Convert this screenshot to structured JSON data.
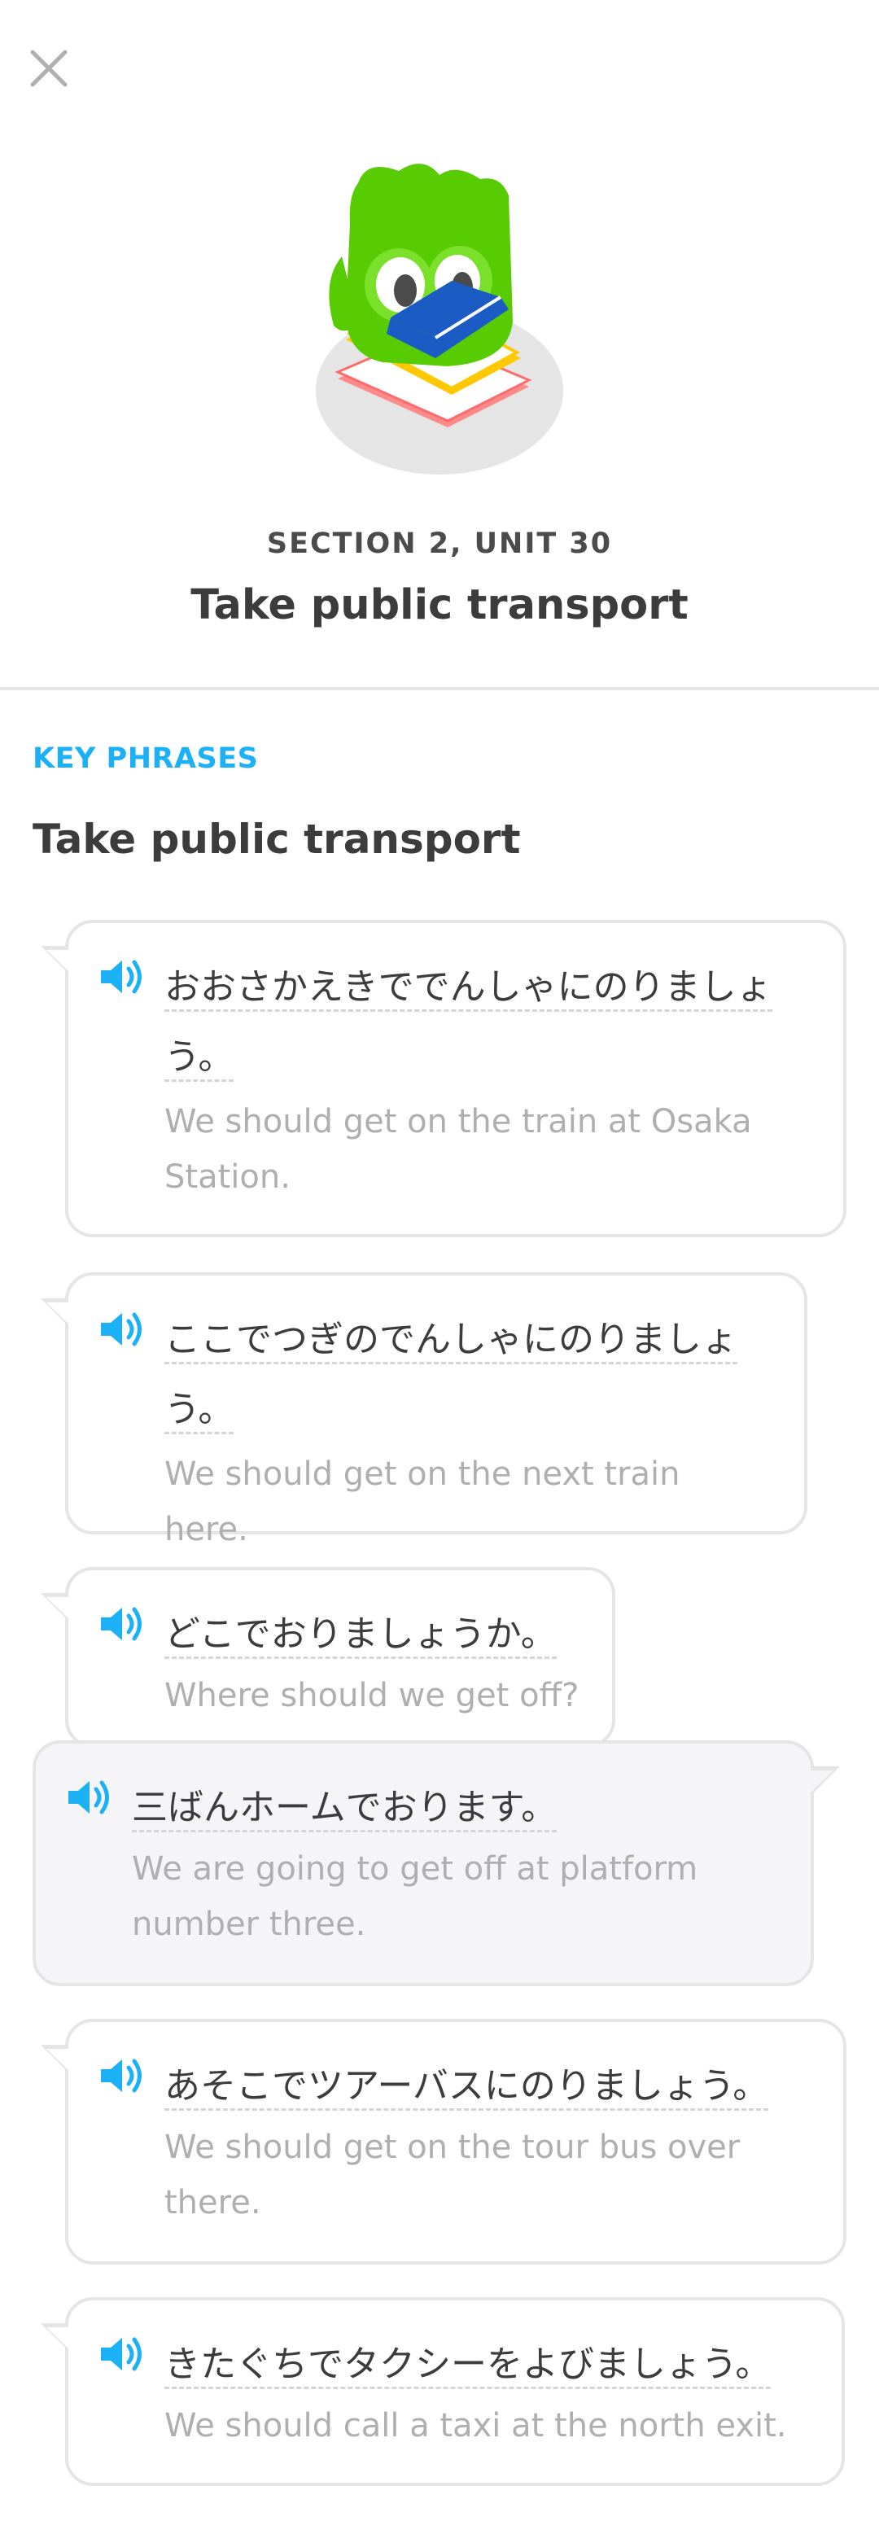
{
  "header": {
    "close_icon": "close-icon",
    "unit_label": "SECTION 2, UNIT 30",
    "unit_title": "Take public transport"
  },
  "key_phrases": {
    "kicker": "KEY PHRASES",
    "title": "Take public transport"
  },
  "phrases": [
    {
      "jp": "おおさかえきででんしゃにのりましょう。",
      "en": "We should get on the train at Osaka Station."
    },
    {
      "jp": "ここでつぎのでんしゃにのりましょう。",
      "en": "We should get on the next train here."
    },
    {
      "jp": "どこでおりましょうか。",
      "en": "Where should we get off?"
    },
    {
      "jp": "三ばんホームでおります。",
      "en": "We are going to get off at platform number three."
    },
    {
      "jp": "あそこでツアーバスにのりましょう。",
      "en": "We should get on the tour bus over there."
    },
    {
      "jp": "きたぐちでタクシーをよびましょう。",
      "en": "We should call a taxi at the north exit."
    }
  ],
  "colors": {
    "accent_blue": "#1cb0f6",
    "mascot_green": "#58cc02",
    "text_dark": "#3c3c3c",
    "text_muted": "#afafaf",
    "border": "#e5e5e5"
  }
}
